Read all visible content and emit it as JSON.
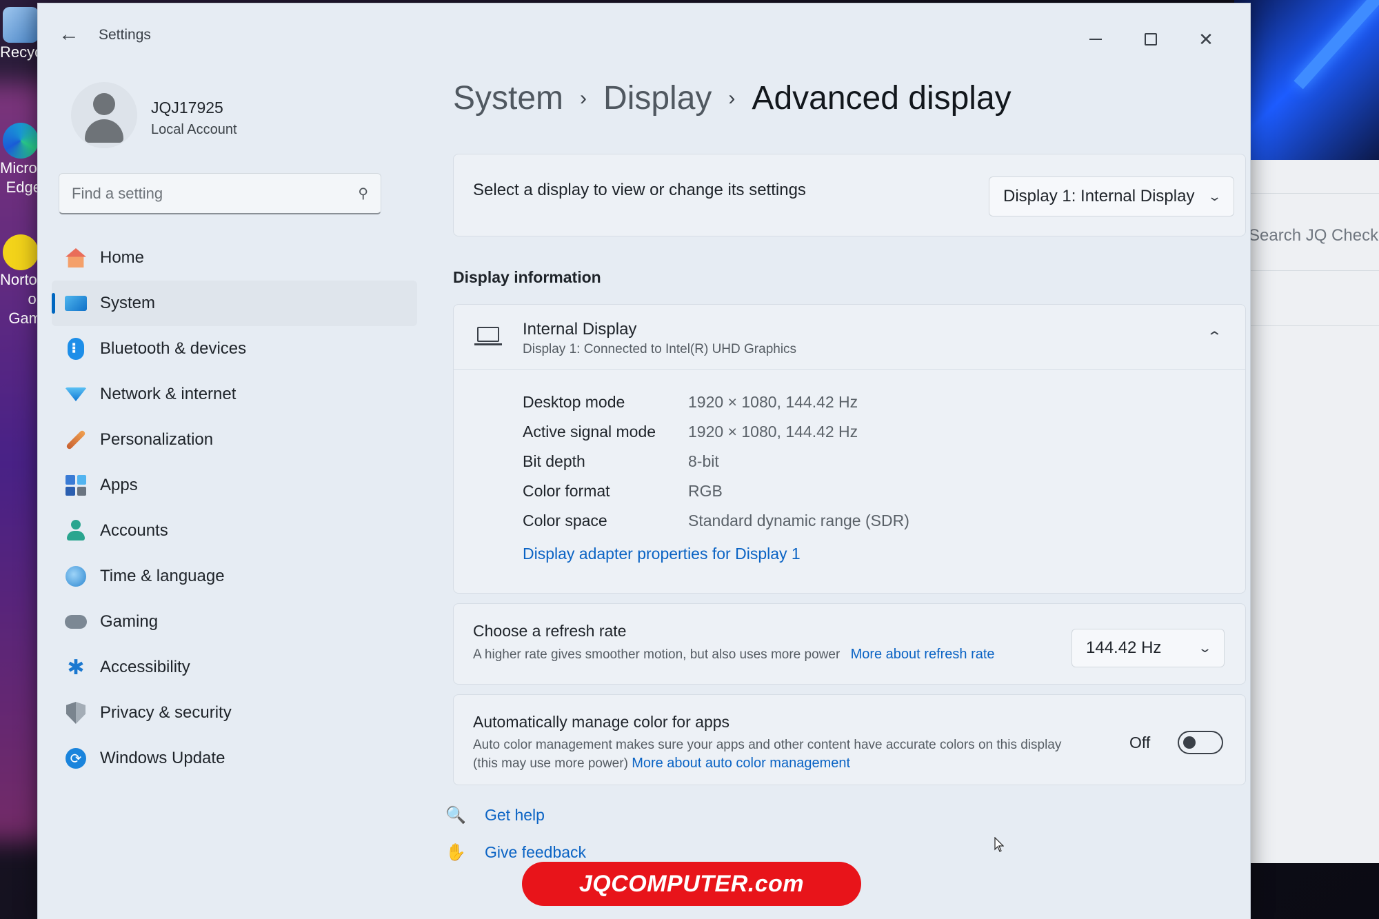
{
  "desktop": {
    "icons": [
      {
        "label": "Recycle",
        "icon": "recycle-bin-icon"
      },
      {
        "label": "Micros Edge",
        "icon": "edge-icon"
      },
      {
        "label": "Norton or Gam",
        "icon": "norton-icon"
      }
    ]
  },
  "background_window": {
    "search_placeholder": "Search JQ Check"
  },
  "window": {
    "title": "Settings",
    "back_icon": "back-arrow-icon",
    "controls": [
      "minimize-icon",
      "maximize-icon",
      "close-icon"
    ]
  },
  "profile": {
    "name": "JQJ17925",
    "account_type": "Local Account"
  },
  "search": {
    "placeholder": "Find a setting"
  },
  "nav": {
    "items": [
      {
        "label": "Home",
        "icon": "home-icon"
      },
      {
        "label": "System",
        "icon": "system-icon",
        "active": true
      },
      {
        "label": "Bluetooth & devices",
        "icon": "bluetooth-icon"
      },
      {
        "label": "Network & internet",
        "icon": "wifi-icon"
      },
      {
        "label": "Personalization",
        "icon": "brush-icon"
      },
      {
        "label": "Apps",
        "icon": "apps-icon"
      },
      {
        "label": "Accounts",
        "icon": "accounts-icon"
      },
      {
        "label": "Time & language",
        "icon": "time-language-icon"
      },
      {
        "label": "Gaming",
        "icon": "gaming-icon"
      },
      {
        "label": "Accessibility",
        "icon": "accessibility-icon"
      },
      {
        "label": "Privacy & security",
        "icon": "shield-icon"
      },
      {
        "label": "Windows Update",
        "icon": "update-icon"
      }
    ]
  },
  "breadcrumb": {
    "items": [
      "System",
      "Display"
    ],
    "current": "Advanced display",
    "separator": "›"
  },
  "display_select": {
    "label": "Select a display to view or change its settings",
    "value": "Display 1: Internal Display"
  },
  "display_info": {
    "section_title": "Display information",
    "name": "Internal Display",
    "subtitle": "Display 1: Connected to Intel(R) UHD Graphics",
    "specs": [
      {
        "label": "Desktop mode",
        "value": "1920 × 1080, 144.42 Hz"
      },
      {
        "label": "Active signal mode",
        "value": "1920 × 1080, 144.42 Hz"
      },
      {
        "label": "Bit depth",
        "value": "8-bit"
      },
      {
        "label": "Color format",
        "value": "RGB"
      },
      {
        "label": "Color space",
        "value": "Standard dynamic range (SDR)"
      }
    ],
    "adapter_link": "Display adapter properties for Display 1"
  },
  "refresh_rate": {
    "title": "Choose a refresh rate",
    "description": "A higher rate gives smoother motion, but also uses more power",
    "link": "More about refresh rate",
    "value": "144.42 Hz"
  },
  "auto_color": {
    "title": "Automatically manage color for apps",
    "description": "Auto color management makes sure your apps and other content have accurate colors on this display (this may use more power)",
    "link": "More about auto color management",
    "state_label": "Off",
    "enabled": false
  },
  "help": {
    "get_help": "Get help",
    "give_feedback": "Give feedback"
  },
  "watermark": {
    "text": "JQCOMPUTER.com"
  },
  "colors": {
    "accent": "#0067c0",
    "link": "#0a63c4",
    "watermark_bg": "#e8141a"
  }
}
